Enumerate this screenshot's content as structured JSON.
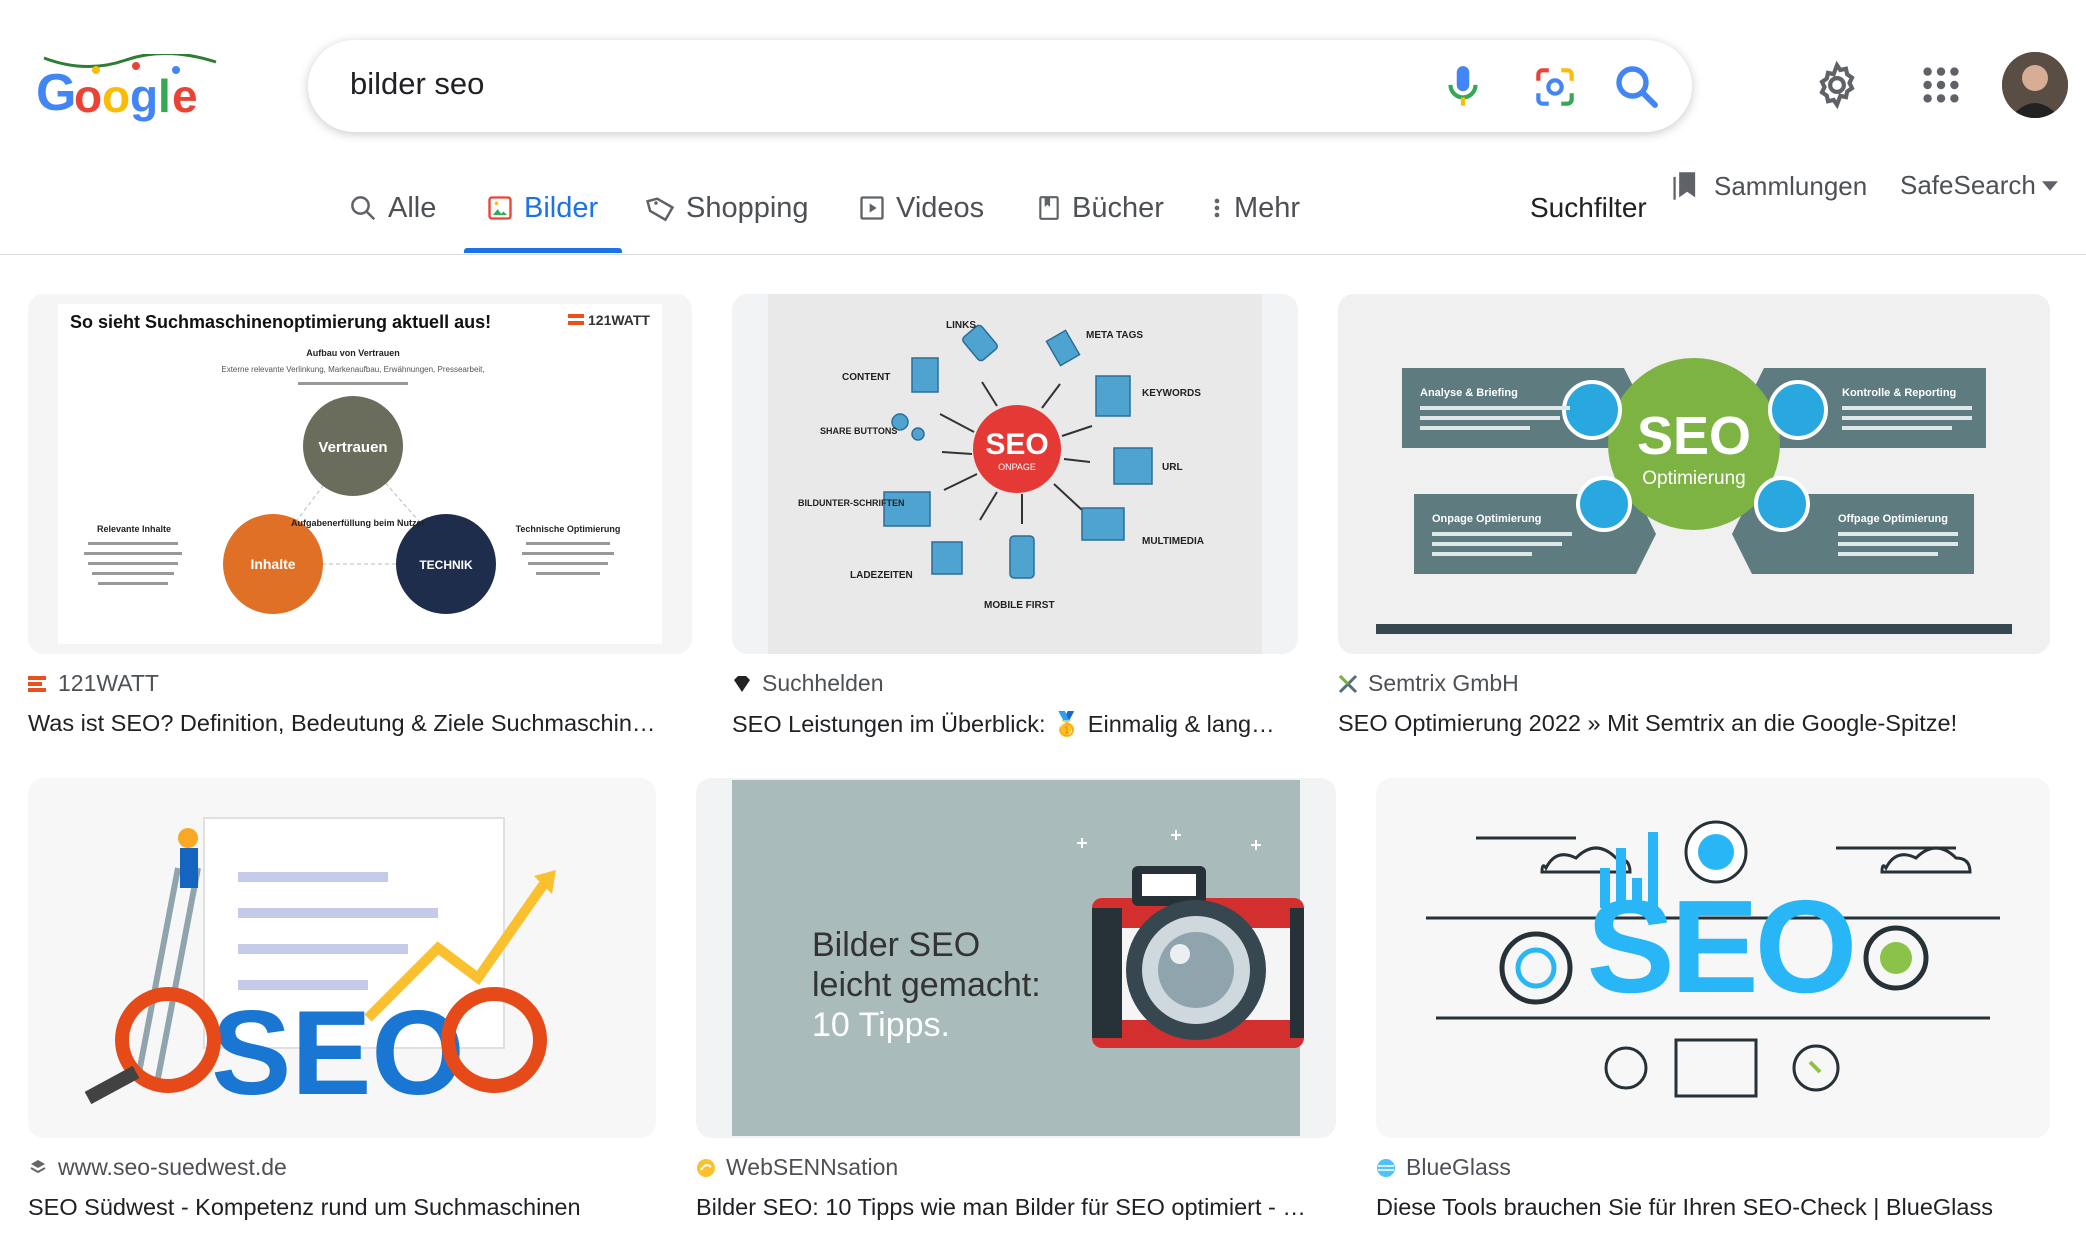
{
  "logo": {
    "text": "Google",
    "icon": "google-doodle-logo"
  },
  "search": {
    "query": "bilder seo"
  },
  "header": {
    "settings_icon": "gear-icon",
    "apps_icon": "apps-grid-icon",
    "avatar": "user-avatar"
  },
  "tabs": [
    {
      "label": "Alle",
      "icon": "search-icon",
      "active": false
    },
    {
      "label": "Bilder",
      "icon": "image-icon",
      "active": true
    },
    {
      "label": "Shopping",
      "icon": "tag-icon",
      "active": false
    },
    {
      "label": "Videos",
      "icon": "play-icon",
      "active": false
    },
    {
      "label": "Bücher",
      "icon": "book-icon",
      "active": false
    },
    {
      "label": "Mehr",
      "icon": "more-vert-icon",
      "active": false
    }
  ],
  "tools": {
    "suchfilter": "Suchfilter",
    "sammlungen": "Sammlungen",
    "safesearch": "SafeSearch"
  },
  "colors": {
    "accent": "#1a73e8",
    "text": "#202124",
    "secondary": "#4d5156"
  },
  "results": [
    {
      "source": "121WATT",
      "title": "Was ist SEO? Definition, Bedeutung & Ziele Suchmaschin…",
      "image": {
        "heading": "So sieht Suchmaschinenoptimierung aktuell aus!",
        "brand": "121WATT",
        "top_label": "Aufbau von Vertrauen",
        "top_desc": "Externe relevante Verlinkung, Markenaufbau, Erwähnungen, Pressearbeit,",
        "circle_top": "Vertrauen",
        "circle_left": "Inhalte",
        "circle_right": "TECHNIK",
        "center_label": "Aufgabenerfüllung beim Nutzer",
        "left_label": "Relevante Inhalte",
        "right_label": "Technische Optimierung"
      }
    },
    {
      "source": "Suchhelden",
      "title": "SEO Leistungen im Überblick: 🥇 Einmalig & lang…",
      "image": {
        "center": "SEO",
        "center_sub": "ONPAGE",
        "labels": [
          "LINKS",
          "META TAGS",
          "CONTENT",
          "KEYWORDS",
          "SHARE BUTTONS",
          "URL",
          "BILDUNTER-SCHRIFTEN",
          "MULTIMEDIA",
          "LADEZEITEN",
          "MOBILE FIRST"
        ]
      }
    },
    {
      "source": "Semtrix GmbH",
      "title": "SEO Optimierung 2022 » Mit Semtrix an die Google-Spitze!",
      "image": {
        "center": "SEO",
        "center_sub": "Optimierung",
        "boxes": [
          "Analyse & Briefing",
          "Kontrolle & Reporting",
          "Onpage Optimierung",
          "Offpage Optimierung"
        ]
      }
    },
    {
      "source": "www.seo-suedwest.de",
      "title": "SEO Südwest - Kompetenz rund um Suchmaschinen",
      "image": {
        "word": "SEO"
      }
    },
    {
      "source": "WebSENNsation",
      "title": "Bilder SEO: 10 Tipps wie man Bilder für SEO optimiert - …",
      "image": {
        "line1": "Bilder SEO",
        "line2": "leicht gemacht:",
        "line3": "10 Tipps."
      }
    },
    {
      "source": "BlueGlass",
      "title": "Diese Tools brauchen Sie für Ihren SEO-Check | BlueGlass",
      "image": {
        "word": "SEO"
      }
    }
  ]
}
